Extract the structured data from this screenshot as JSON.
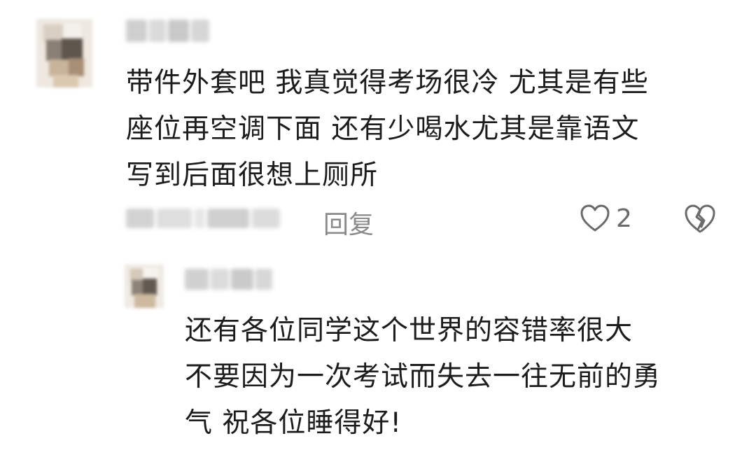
{
  "comments": [
    {
      "username": "",
      "text": "带件外套吧 我真觉得考场很冷 尤其是有些\n座位再空调下面 还有少喝水尤其是靠语文\n写到后面很想上厕所",
      "timestamp": "",
      "reply_label": "回复",
      "like_count": "2"
    },
    {
      "username": "",
      "text": "还有各位同学这个世界的容错率很大\n不要因为一次考试而失去一往无前的勇\n气 祝各位睡得好!"
    }
  ],
  "icons": {
    "like": "heart-outline-icon",
    "dislike": "broken-heart-icon"
  },
  "colors": {
    "text": "#1c1c1c",
    "secondary": "#8a8a8a",
    "icon": "#6a6a6a",
    "background": "#ffffff"
  }
}
